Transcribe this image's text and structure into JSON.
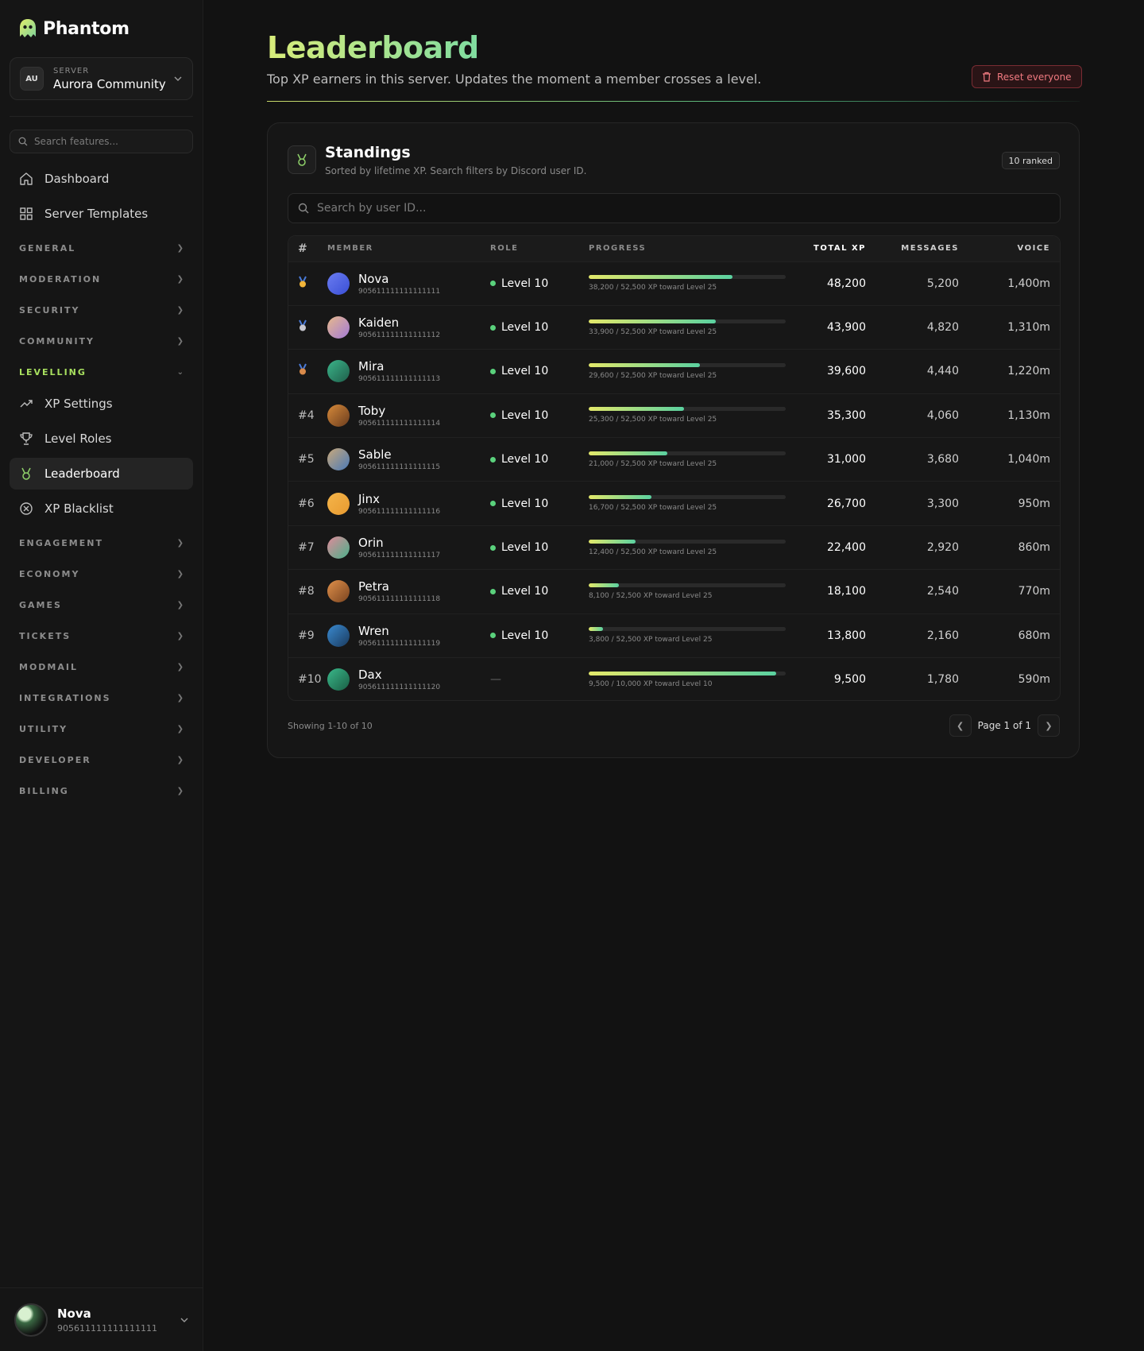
{
  "brand": {
    "name": "Phantom"
  },
  "server": {
    "label": "SERVER",
    "avatar": "AU",
    "name": "Aurora Community"
  },
  "sidebar": {
    "search_placeholder": "Search features...",
    "top_items": [
      {
        "label": "Dashboard",
        "icon": "home-icon"
      },
      {
        "label": "Server Templates",
        "icon": "grid-icon"
      }
    ],
    "sections_before": [
      "GENERAL",
      "MODERATION",
      "SECURITY",
      "COMMUNITY"
    ],
    "open_section": "LEVELLING",
    "levelling_items": [
      {
        "label": "XP Settings",
        "icon": "trend-up-icon"
      },
      {
        "label": "Level Roles",
        "icon": "trophy-icon"
      },
      {
        "label": "Leaderboard",
        "icon": "medal-icon",
        "active": true
      },
      {
        "label": "XP Blacklist",
        "icon": "x-circle-icon"
      }
    ],
    "sections_after": [
      "ENGAGEMENT",
      "ECONOMY",
      "GAMES",
      "TICKETS",
      "MODMAIL",
      "INTEGRATIONS",
      "UTILITY",
      "DEVELOPER",
      "BILLING"
    ]
  },
  "user": {
    "name": "Nova",
    "id": "905611111111111111"
  },
  "header": {
    "title": "Leaderboard",
    "subtitle": "Top XP earners in this server. Updates the moment a member crosses a level.",
    "reset_label": "Reset everyone"
  },
  "standings": {
    "title": "Standings",
    "subtitle": "Sorted by lifetime XP. Search filters by Discord user ID.",
    "badge": "10 ranked",
    "search_placeholder": "Search by user ID...",
    "columns": [
      "#",
      "MEMBER",
      "ROLE",
      "PROGRESS",
      "TOTAL XP",
      "MESSAGES",
      "VOICE"
    ],
    "rows": [
      {
        "rank": "",
        "medal": "gold",
        "name": "Nova",
        "id": "905611111111111111",
        "role": "Level 10",
        "progress_text": "38,200 / 52,500 XP toward Level 25",
        "progress": 0.728,
        "xp": "48,200",
        "messages": "5,200",
        "voice": "1,400m",
        "avatar": [
          "#6a7cf0",
          "#3a4fd6"
        ]
      },
      {
        "rank": "",
        "medal": "silver",
        "name": "Kaiden",
        "id": "905611111111111112",
        "role": "Level 10",
        "progress_text": "33,900 / 52,500 XP toward Level 25",
        "progress": 0.646,
        "xp": "43,900",
        "messages": "4,820",
        "voice": "1,310m",
        "avatar": [
          "#e7b98a",
          "#a27ad8"
        ]
      },
      {
        "rank": "",
        "medal": "bronze",
        "name": "Mira",
        "id": "905611111111111113",
        "role": "Level 10",
        "progress_text": "29,600 / 52,500 XP toward Level 25",
        "progress": 0.564,
        "xp": "39,600",
        "messages": "4,440",
        "voice": "1,220m",
        "avatar": [
          "#3bb58a",
          "#1f5e4a"
        ]
      },
      {
        "rank": "#4",
        "medal": "",
        "name": "Toby",
        "id": "905611111111111114",
        "role": "Level 10",
        "progress_text": "25,300 / 52,500 XP toward Level 25",
        "progress": 0.482,
        "xp": "35,300",
        "messages": "4,060",
        "voice": "1,130m",
        "avatar": [
          "#d78a3a",
          "#6a3c1e"
        ]
      },
      {
        "rank": "#5",
        "medal": "",
        "name": "Sable",
        "id": "905611111111111115",
        "role": "Level 10",
        "progress_text": "21,000 / 52,500 XP toward Level 25",
        "progress": 0.4,
        "xp": "31,000",
        "messages": "3,680",
        "voice": "1,040m",
        "avatar": [
          "#c9a87a",
          "#4a7ab8"
        ]
      },
      {
        "rank": "#6",
        "medal": "",
        "name": "Jinx",
        "id": "905611111111111116",
        "role": "Level 10",
        "progress_text": "16,700 / 52,500 XP toward Level 25",
        "progress": 0.318,
        "xp": "26,700",
        "messages": "3,300",
        "voice": "950m",
        "avatar": [
          "#f5b54a",
          "#e89a30"
        ]
      },
      {
        "rank": "#7",
        "medal": "",
        "name": "Orin",
        "id": "905611111111111117",
        "role": "Level 10",
        "progress_text": "12,400 / 52,500 XP toward Level 25",
        "progress": 0.236,
        "xp": "22,400",
        "messages": "2,920",
        "voice": "860m",
        "avatar": [
          "#e08a9a",
          "#4ab08a"
        ]
      },
      {
        "rank": "#8",
        "medal": "",
        "name": "Petra",
        "id": "905611111111111118",
        "role": "Level 10",
        "progress_text": "8,100 / 52,500 XP toward Level 25",
        "progress": 0.154,
        "xp": "18,100",
        "messages": "2,540",
        "voice": "770m",
        "avatar": [
          "#e0904a",
          "#7a4420"
        ]
      },
      {
        "rank": "#9",
        "medal": "",
        "name": "Wren",
        "id": "905611111111111119",
        "role": "Level 10",
        "progress_text": "3,800 / 52,500 XP toward Level 25",
        "progress": 0.072,
        "xp": "13,800",
        "messages": "2,160",
        "voice": "680m",
        "avatar": [
          "#3a8ad0",
          "#1a3a5e"
        ]
      },
      {
        "rank": "#10",
        "medal": "",
        "name": "Dax",
        "id": "905611111111111120",
        "role": "",
        "role_none": "—",
        "progress_text": "9,500 / 10,000 XP toward Level 10",
        "progress": 0.95,
        "xp": "9,500",
        "messages": "1,780",
        "voice": "590m",
        "avatar": [
          "#3ab88a",
          "#1a5e44"
        ]
      }
    ],
    "showing": "Showing 1-10 of 10",
    "page_text": "Page 1 of 1"
  },
  "colors": {
    "accent": "#a8e05f",
    "danger": "#f07a80",
    "online": "#5ad17c",
    "gold": "#f2b53a",
    "silver": "#c8c8d0",
    "bronze": "#d98a4a"
  }
}
